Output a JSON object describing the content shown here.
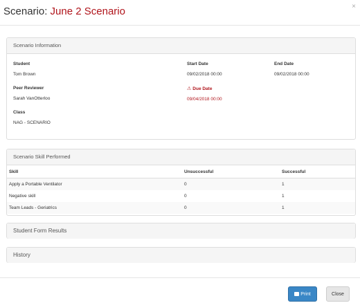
{
  "header": {
    "title_prefix": "Scenario:",
    "scenario_name": "June 2 Scenario",
    "close_label": "×"
  },
  "info": {
    "heading": "Scenario Information",
    "student_label": "Student",
    "student_value": "Tom Brown",
    "start_label": "Start Date",
    "start_value": "09/02/2018 00:00",
    "end_label": "End Date",
    "end_value": "09/02/2018 00:00",
    "peer_label": "Peer Reviewer",
    "peer_value": "Sarah VanOtterloo",
    "due_label": "Due Date",
    "due_value": "09/04/2018 00:00",
    "class_label": "Class",
    "class_value": "NAG - SCENARIO"
  },
  "skills": {
    "heading": "Scenario Skill Performed",
    "columns": [
      "Skill",
      "Unsuccessful",
      "Successful"
    ],
    "rows": [
      {
        "skill": "Apply a Portable Ventilator",
        "unsuccessful": "0",
        "successful": "1"
      },
      {
        "skill": "Negative skill",
        "unsuccessful": "0",
        "successful": "1"
      },
      {
        "skill": "Team Leads - Geriatrics",
        "unsuccessful": "0",
        "successful": "1"
      }
    ]
  },
  "sections": {
    "form_results": "Student Form Results",
    "history": "History"
  },
  "footer": {
    "print_label": "Print",
    "close_label": "Close"
  },
  "colors": {
    "accent_red": "#b0141b",
    "print_blue": "#3a87c6"
  },
  "icons": {
    "due_warning": "warning-triangle-icon",
    "print": "printer-icon",
    "close": "close-icon"
  }
}
